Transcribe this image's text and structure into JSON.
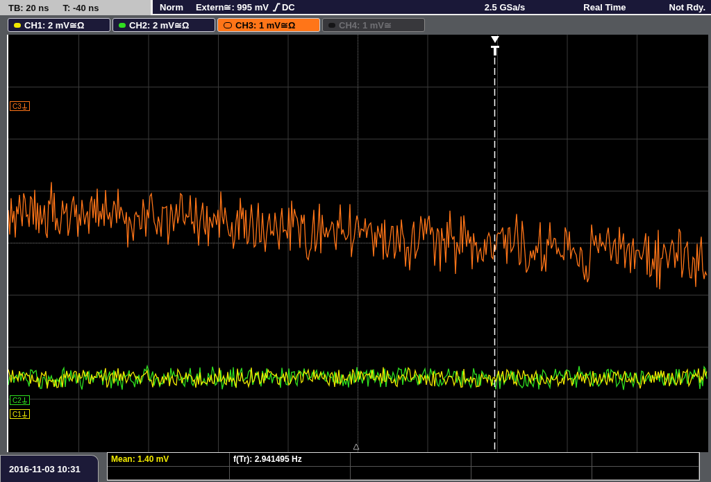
{
  "top_bar": {
    "timebase": "TB: 20 ns",
    "trigger_time": "T: -40 ns",
    "trigger_mode": "Norm",
    "trigger_source": "Extern≅: 995 mV",
    "trigger_coupling": "DC",
    "sample_rate": "2.5 GSa/s",
    "acquisition": "Real Time",
    "status": "Not Rdy."
  },
  "channels": [
    {
      "label": "CH1: 2 mV",
      "coupling": "≅Ω",
      "color": "#f0e800",
      "selected": false,
      "disabled": false
    },
    {
      "label": "CH2: 2 mV",
      "coupling": "≅Ω",
      "color": "#30e020",
      "selected": false,
      "disabled": false
    },
    {
      "label": "CH3: 1 mV",
      "coupling": "≅Ω",
      "color": "#ff7518",
      "selected": true,
      "disabled": false
    },
    {
      "label": "CH4: 1 mV",
      "coupling": "≅",
      "color": "#151517",
      "selected": false,
      "disabled": true
    }
  ],
  "markers": [
    {
      "label": "C3",
      "color": "#ff7518"
    },
    {
      "label": "C2",
      "color": "#30e020"
    },
    {
      "label": "C1",
      "color": "#f0e800"
    }
  ],
  "date_time": "2016-11-03 10:31",
  "measurements": [
    {
      "text": "Mean: 1.40 mV",
      "color": "#f0e800"
    },
    {
      "text": "f(Tr): 2.941495 Hz",
      "color": "#ffffff"
    }
  ]
}
